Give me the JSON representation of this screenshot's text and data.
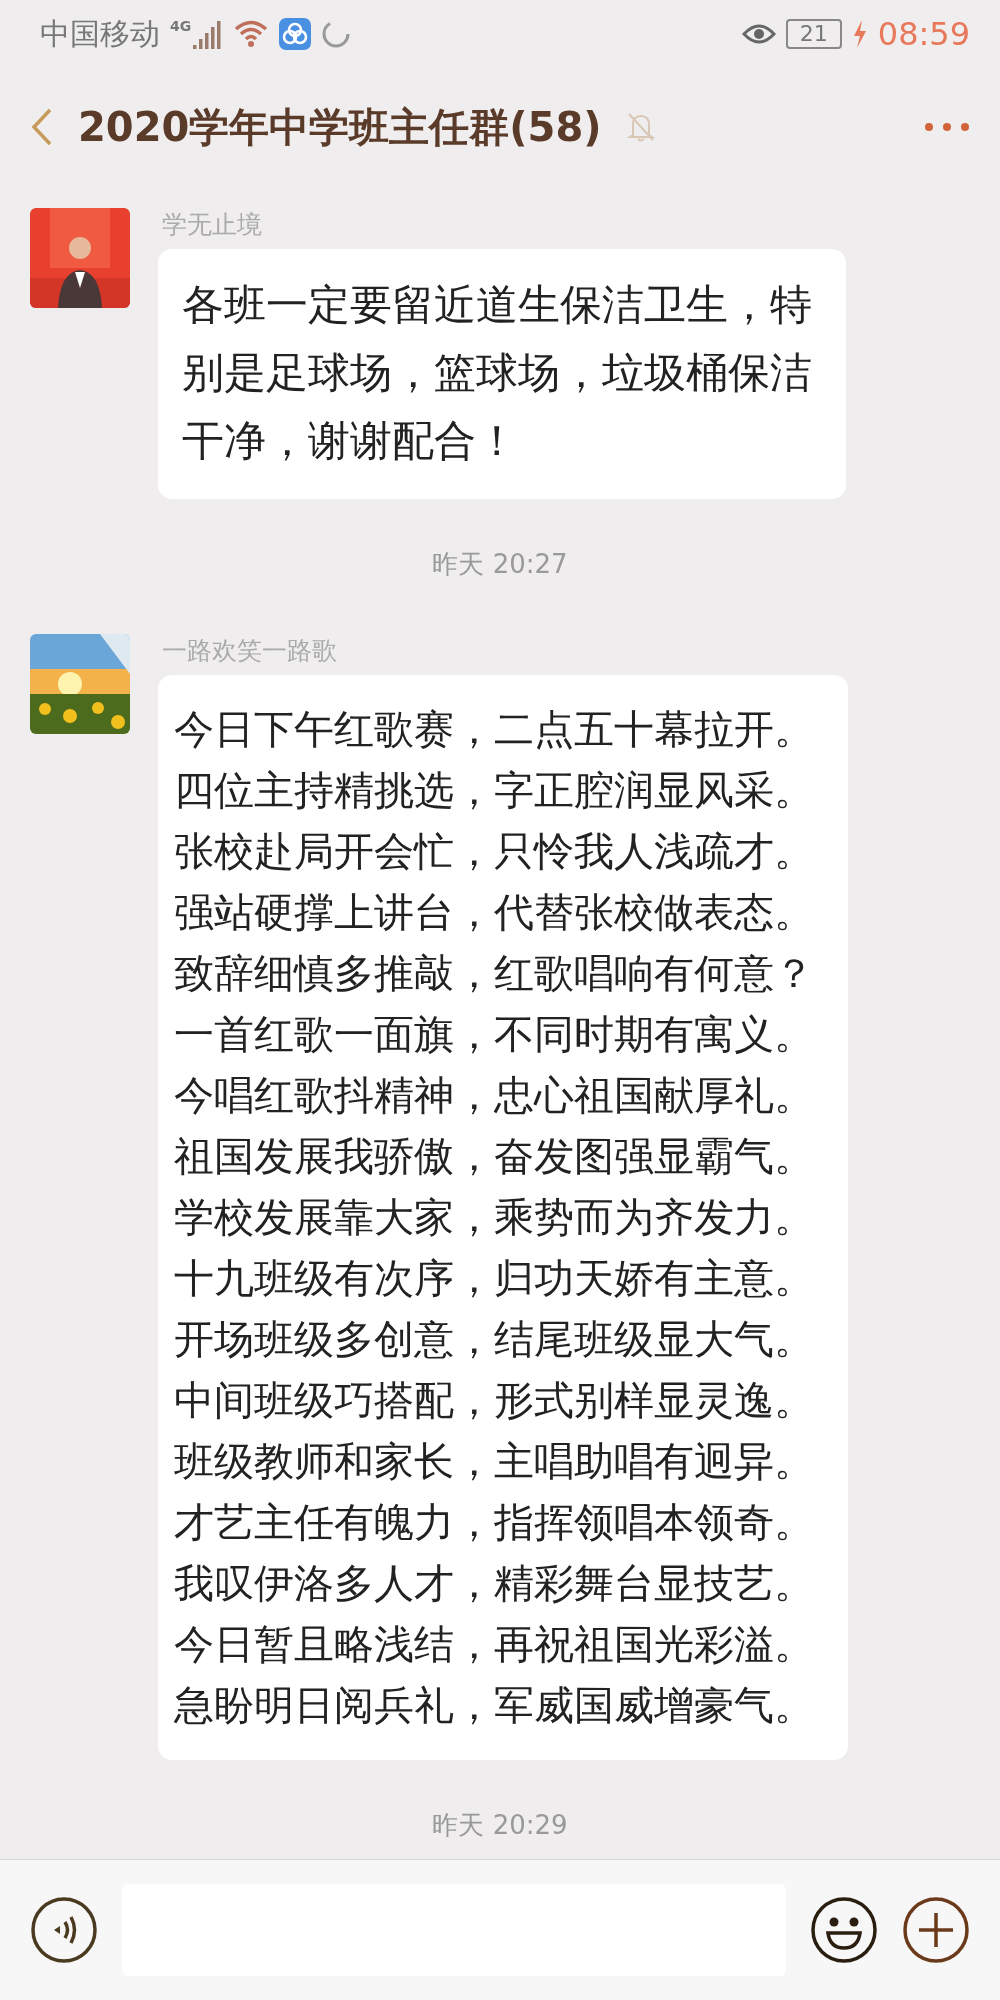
{
  "status_bar": {
    "carrier": "中国移动",
    "network": "4G",
    "battery": "21",
    "time": "08:59"
  },
  "header": {
    "title": "2020学年中学班主任群(58)",
    "muted": true
  },
  "messages": [
    {
      "kind": "message",
      "sender": "学无止境",
      "text": "各班一定要留近道生保洁卫生，特别是足球场，篮球场，垃圾桶保洁干净，谢谢配合！"
    },
    {
      "kind": "time",
      "text": "昨天 20:27"
    },
    {
      "kind": "message",
      "sender": "一路欢笑一路歌",
      "lines": [
        "今日下午红歌赛，二点五十幕拉开。",
        "四位主持精挑选，字正腔润显风采。",
        "张校赴局开会忙，只怜我人浅疏才。",
        "强站硬撑上讲台，代替张校做表态。",
        "致辞细慎多推敲，红歌唱响有何意？",
        "一首红歌一面旗，不同时期有寓义。",
        "今唱红歌抖精神，忠心祖国献厚礼。",
        "祖国发展我骄傲，奋发图强显霸气。",
        "学校发展靠大家，乘势而为齐发力。",
        "十九班级有次序，归功天娇有主意。",
        "开场班级多创意，结尾班级显大气。",
        "中间班级巧搭配，形式别样显灵逸。",
        "班级教师和家长，主唱助唱有迥异。",
        "才艺主任有魄力，指挥领唱本领奇。",
        "我叹伊洛多人才，精彩舞台显技艺。",
        "今日暂且略浅结，再祝祖国光彩溢。",
        "急盼明日阅兵礼，军威国威增豪气。"
      ]
    },
    {
      "kind": "time",
      "text": "昨天 20:29"
    }
  ]
}
